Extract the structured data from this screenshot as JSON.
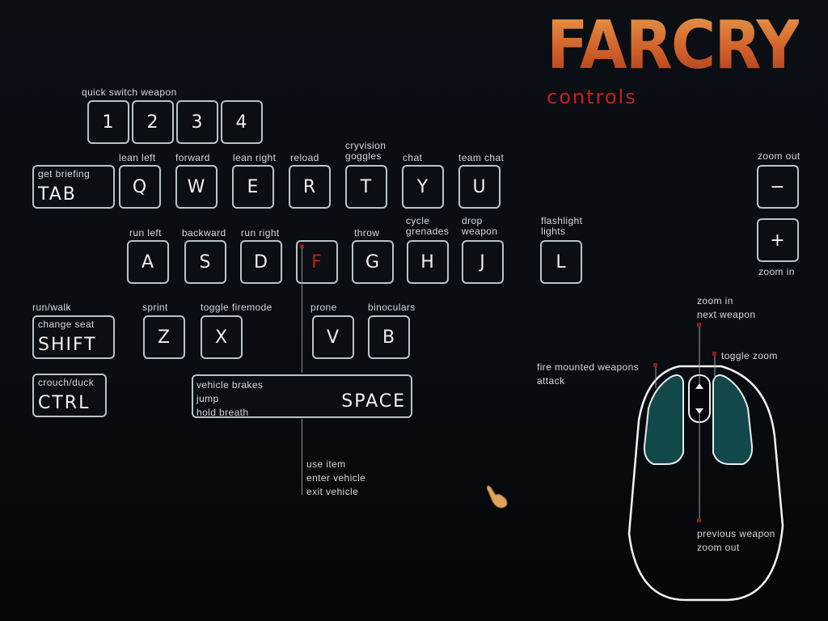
{
  "logo": {
    "title": "FARCRY",
    "subtitle": "controls"
  },
  "colors": {
    "accent_red": "#c0221e",
    "key_border": "#b9c3c8",
    "mouse_button_fill": "#13484b",
    "logo_orange": "#d2642a"
  },
  "number_row": {
    "label": "quick switch weapon",
    "keys": [
      "1",
      "2",
      "3",
      "4"
    ]
  },
  "qwerty_row": {
    "tab": {
      "key": "TAB",
      "action": "get briefing"
    },
    "keys": [
      {
        "key": "Q",
        "action": "lean left"
      },
      {
        "key": "W",
        "action": "forward"
      },
      {
        "key": "E",
        "action": "lean right"
      },
      {
        "key": "R",
        "action": "reload"
      },
      {
        "key": "T",
        "action": "cryvision goggles"
      },
      {
        "key": "Y",
        "action": "chat"
      },
      {
        "key": "U",
        "action": "team chat"
      }
    ]
  },
  "home_row": {
    "keys": [
      {
        "key": "A",
        "action": "run left"
      },
      {
        "key": "S",
        "action": "backward"
      },
      {
        "key": "D",
        "action": "run right"
      },
      {
        "key": "F",
        "action": ""
      },
      {
        "key": "G",
        "action": "throw"
      },
      {
        "key": "H",
        "action": "cycle grenades"
      },
      {
        "key": "J",
        "action": "drop weapon"
      },
      {
        "key": "L",
        "action": "flashlight lights"
      }
    ],
    "f_actions": [
      "use item",
      "enter vehicle",
      "exit vehicle"
    ]
  },
  "bottom_row": {
    "shift": {
      "key": "SHIFT",
      "action_outer": "run/walk",
      "action_inner": "change seat"
    },
    "ctrl": {
      "key": "CTRL",
      "action": "crouch/duck"
    },
    "keys": [
      {
        "key": "Z",
        "action": "sprint"
      },
      {
        "key": "X",
        "action": "toggle firemode"
      },
      {
        "key": "V",
        "action": "prone"
      },
      {
        "key": "B",
        "action": "binoculars"
      }
    ],
    "space": {
      "key": "SPACE",
      "actions": [
        "vehicle brakes",
        "jump",
        "hold breath"
      ]
    }
  },
  "zoom_keys": {
    "minus": {
      "key": "−",
      "action": "zoom out"
    },
    "plus": {
      "key": "+",
      "action": "zoom in"
    }
  },
  "mouse": {
    "left_button": [
      "fire mounted weapons",
      "attack"
    ],
    "right_button": "toggle zoom",
    "wheel_up": [
      "zoom in",
      "next weapon"
    ],
    "wheel_down": [
      "previous weapon",
      "zoom out"
    ]
  }
}
